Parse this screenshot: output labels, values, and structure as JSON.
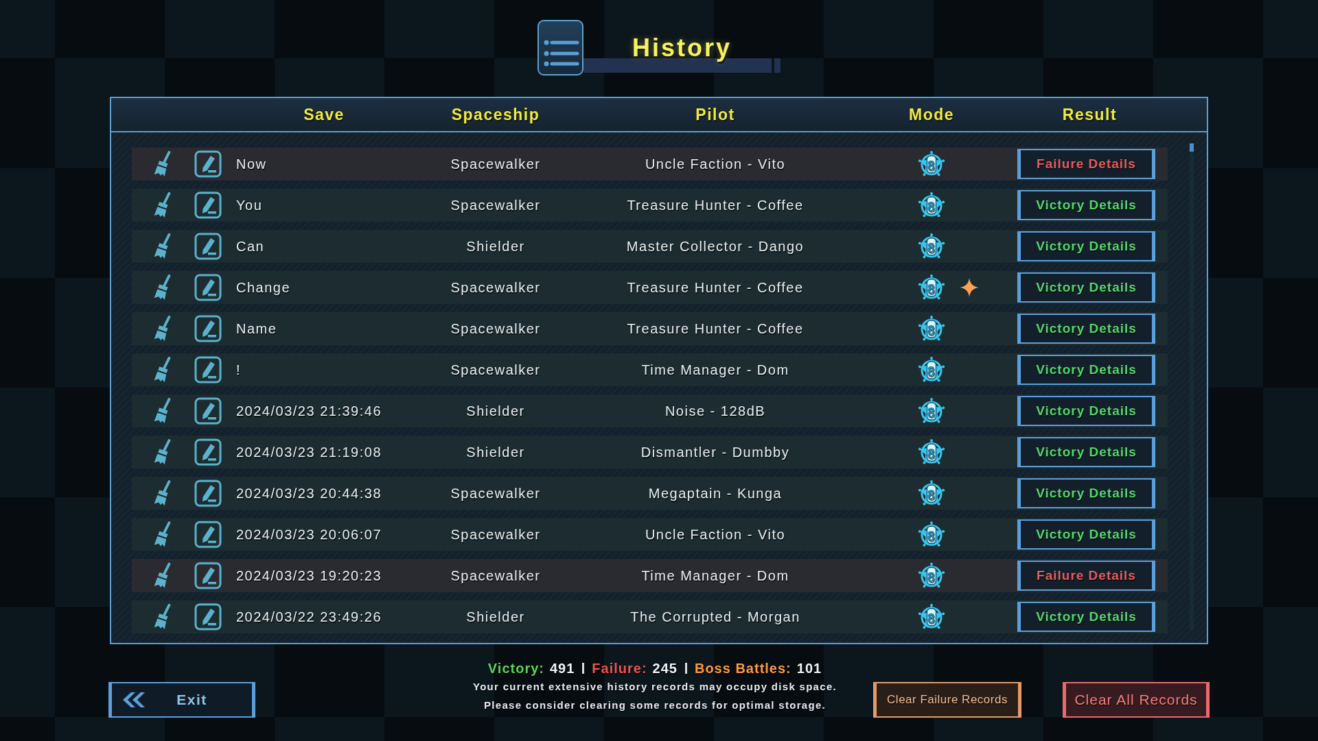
{
  "header": {
    "title": "History"
  },
  "table": {
    "columns": [
      "Save",
      "Spaceship",
      "Pilot",
      "Mode",
      "Result"
    ],
    "rows": [
      {
        "save": "Now",
        "spaceship": "Spacewalker",
        "pilot": "Uncle Faction - Vito",
        "mode": "8",
        "boss": false,
        "result": {
          "kind": "failure",
          "label": "Failure Details"
        }
      },
      {
        "save": "You",
        "spaceship": "Spacewalker",
        "pilot": "Treasure Hunter - Coffee",
        "mode": "8",
        "boss": false,
        "result": {
          "kind": "victory",
          "label": "Victory Details"
        }
      },
      {
        "save": "Can",
        "spaceship": "Shielder",
        "pilot": "Master Collector - Dango",
        "mode": "8",
        "boss": false,
        "result": {
          "kind": "victory",
          "label": "Victory Details"
        }
      },
      {
        "save": "Change",
        "spaceship": "Spacewalker",
        "pilot": "Treasure Hunter - Coffee",
        "mode": "8",
        "boss": true,
        "result": {
          "kind": "victory",
          "label": "Victory Details"
        }
      },
      {
        "save": "Name",
        "spaceship": "Spacewalker",
        "pilot": "Treasure Hunter - Coffee",
        "mode": "8",
        "boss": false,
        "result": {
          "kind": "victory",
          "label": "Victory Details"
        }
      },
      {
        "save": "!",
        "spaceship": "Spacewalker",
        "pilot": "Time Manager - Dom",
        "mode": "8",
        "boss": false,
        "result": {
          "kind": "victory",
          "label": "Victory Details"
        }
      },
      {
        "save": "2024/03/23 21:39:46",
        "spaceship": "Shielder",
        "pilot": "Noise - 128dB",
        "mode": "8",
        "boss": false,
        "result": {
          "kind": "victory",
          "label": "Victory Details"
        }
      },
      {
        "save": "2024/03/23 21:19:08",
        "spaceship": "Shielder",
        "pilot": "Dismantler - Dumbby",
        "mode": "8",
        "boss": false,
        "result": {
          "kind": "victory",
          "label": "Victory Details"
        }
      },
      {
        "save": "2024/03/23 20:44:38",
        "spaceship": "Spacewalker",
        "pilot": "Megaptain - Kunga",
        "mode": "8",
        "boss": false,
        "result": {
          "kind": "victory",
          "label": "Victory Details"
        }
      },
      {
        "save": "2024/03/23 20:06:07",
        "spaceship": "Spacewalker",
        "pilot": "Uncle Faction - Vito",
        "mode": "8",
        "boss": false,
        "result": {
          "kind": "victory",
          "label": "Victory Details"
        }
      },
      {
        "save": "2024/03/23 19:20:23",
        "spaceship": "Spacewalker",
        "pilot": "Time Manager - Dom",
        "mode": "8",
        "boss": false,
        "result": {
          "kind": "failure",
          "label": "Failure Details"
        }
      },
      {
        "save": "2024/03/22 23:49:26",
        "spaceship": "Shielder",
        "pilot": "The Corrupted - Morgan",
        "mode": "8",
        "boss": false,
        "result": {
          "kind": "victory",
          "label": "Victory Details"
        }
      }
    ]
  },
  "footer": {
    "exit": "Exit",
    "stats": [
      {
        "label": "Victory:",
        "value": "491",
        "color": "#5ad35a"
      },
      {
        "label": "Failure:",
        "value": "245",
        "color": "#f05252"
      },
      {
        "label": "Boss Battles:",
        "value": "101",
        "color": "#ff9a3a"
      }
    ],
    "notice": [
      "Your current extensive history records may occupy disk space.",
      "Please consider clearing some records for optimal storage."
    ],
    "buttons": [
      {
        "kind": "clear_failures",
        "label": "Clear Failure Records"
      },
      {
        "kind": "clear_all",
        "label": "Clear All Records"
      }
    ]
  }
}
